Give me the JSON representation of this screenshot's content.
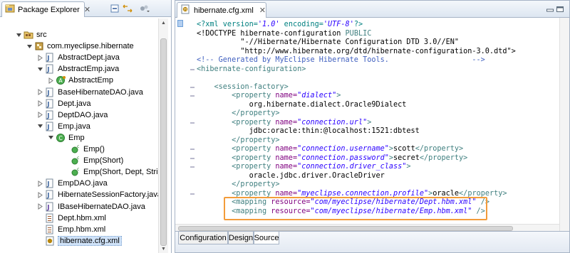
{
  "package_explorer": {
    "tab_label": "Package Explorer",
    "close_glyph": "✕",
    "toolbar_icons": [
      "collapse-all-icon",
      "link-with-editor-icon",
      "view-menu-icon"
    ],
    "tree": [
      {
        "label": "src",
        "icon": "source-folder-icon",
        "twisty": "expanded",
        "indent": 0
      },
      {
        "label": "com.myeclipse.hibernate",
        "icon": "package-icon",
        "twisty": "expanded",
        "indent": 1
      },
      {
        "label": "AbstractDept.java",
        "icon": "java-file-icon",
        "twisty": "collapsed",
        "indent": 2
      },
      {
        "label": "AbstractEmp.java",
        "icon": "java-file-icon",
        "twisty": "expanded",
        "indent": 2
      },
      {
        "label": "AbstractEmp",
        "icon": "abstract-class-icon",
        "twisty": "collapsed",
        "indent": 3
      },
      {
        "label": "BaseHibernateDAO.java",
        "icon": "java-file-icon",
        "twisty": "collapsed",
        "indent": 2
      },
      {
        "label": "Dept.java",
        "icon": "java-file-icon",
        "twisty": "collapsed",
        "indent": 2
      },
      {
        "label": "DeptDAO.java",
        "icon": "java-file-icon",
        "twisty": "collapsed",
        "indent": 2
      },
      {
        "label": "Emp.java",
        "icon": "java-file-icon",
        "twisty": "expanded",
        "indent": 2
      },
      {
        "label": "Emp",
        "icon": "class-icon",
        "twisty": "expanded",
        "indent": 3
      },
      {
        "label": "Emp()",
        "icon": "constructor-icon",
        "twisty": "none",
        "indent": 4
      },
      {
        "label": "Emp(Short)",
        "icon": "constructor-icon",
        "twisty": "none",
        "indent": 4
      },
      {
        "label": "Emp(Short, Dept, Strir",
        "icon": "constructor-icon",
        "twisty": "none",
        "indent": 4
      },
      {
        "label": "EmpDAO.java",
        "icon": "java-file-icon",
        "twisty": "collapsed",
        "indent": 2
      },
      {
        "label": "HibernateSessionFactory.java",
        "icon": "java-file-icon",
        "twisty": "collapsed",
        "indent": 2
      },
      {
        "label": "IBaseHibernateDAO.java",
        "icon": "interface-file-icon",
        "twisty": "collapsed",
        "indent": 2
      },
      {
        "label": "Dept.hbm.xml",
        "icon": "hbm-xml-icon",
        "twisty": "none",
        "indent": 2
      },
      {
        "label": "Emp.hbm.xml",
        "icon": "hbm-xml-icon",
        "twisty": "none",
        "indent": 2
      },
      {
        "label": "hibernate.cfg.xml",
        "icon": "hibernate-cfg-icon",
        "twisty": "none",
        "indent": 2,
        "selected": true
      }
    ]
  },
  "editor": {
    "tab_label": "hibernate.cfg.xml",
    "close_glyph": "✕",
    "lines": [
      [
        {
          "t": "<?xml version=",
          "c": "c-proc"
        },
        {
          "t": "'1.0'",
          "c": "c-val"
        },
        {
          "t": " encoding=",
          "c": "c-proc"
        },
        {
          "t": "'UTF-8'",
          "c": "c-val"
        },
        {
          "t": "?>",
          "c": "c-proc"
        }
      ],
      [
        {
          "t": "<!DOCTYPE hibernate-configuration ",
          "c": "c-dt"
        },
        {
          "t": "PUBLIC",
          "c": "c-tag"
        }
      ],
      [
        {
          "t": "          \"-//Hibernate/Hibernate Configuration DTD 3.0//EN\"",
          "c": "c-dt"
        }
      ],
      [
        {
          "t": "          \"http://www.hibernate.org/dtd/hibernate-configuration-3.0.dtd\">",
          "c": "c-dt"
        }
      ],
      [
        {
          "t": "<!-- Generated by MyEclipse Hibernate Tools.                   -->",
          "c": "c-cm"
        }
      ],
      [
        {
          "t": "<hibernate-configuration>",
          "c": "c-tag"
        }
      ],
      [],
      [
        {
          "t": "    <session-factory>",
          "c": "c-tag"
        }
      ],
      [
        {
          "t": "        <property ",
          "c": "c-tag"
        },
        {
          "t": "name=",
          "c": "c-attr"
        },
        {
          "t": "\"dialect\"",
          "c": "c-val"
        },
        {
          "t": ">",
          "c": "c-tag"
        }
      ],
      [
        {
          "t": "            org.hibernate.dialect.Oracle9Dialect",
          "c": "c-txt"
        }
      ],
      [
        {
          "t": "        </property>",
          "c": "c-tag"
        }
      ],
      [
        {
          "t": "        <property ",
          "c": "c-tag"
        },
        {
          "t": "name=",
          "c": "c-attr"
        },
        {
          "t": "\"connection.url\"",
          "c": "c-val"
        },
        {
          "t": ">",
          "c": "c-tag"
        }
      ],
      [
        {
          "t": "            jdbc:oracle:thin:@localhost:1521:dbtest",
          "c": "c-txt"
        }
      ],
      [
        {
          "t": "        </property>",
          "c": "c-tag"
        }
      ],
      [
        {
          "t": "        <property ",
          "c": "c-tag"
        },
        {
          "t": "name=",
          "c": "c-attr"
        },
        {
          "t": "\"connection.username\"",
          "c": "c-val"
        },
        {
          "t": ">",
          "c": "c-tag"
        },
        {
          "t": "scott",
          "c": "c-txt"
        },
        {
          "t": "</property>",
          "c": "c-tag"
        }
      ],
      [
        {
          "t": "        <property ",
          "c": "c-tag"
        },
        {
          "t": "name=",
          "c": "c-attr"
        },
        {
          "t": "\"connection.password\"",
          "c": "c-val"
        },
        {
          "t": ">",
          "c": "c-tag"
        },
        {
          "t": "secret",
          "c": "c-txt"
        },
        {
          "t": "</property>",
          "c": "c-tag"
        }
      ],
      [
        {
          "t": "        <property ",
          "c": "c-tag"
        },
        {
          "t": "name=",
          "c": "c-attr"
        },
        {
          "t": "\"connection.driver_class\"",
          "c": "c-val"
        },
        {
          "t": ">",
          "c": "c-tag"
        }
      ],
      [
        {
          "t": "            oracle.jdbc.driver.OracleDriver",
          "c": "c-txt"
        }
      ],
      [
        {
          "t": "        </property>",
          "c": "c-tag"
        }
      ],
      [
        {
          "t": "        <property ",
          "c": "c-tag"
        },
        {
          "t": "name=",
          "c": "c-attr"
        },
        {
          "t": "\"myeclipse.connection.profile\"",
          "c": "c-val"
        },
        {
          "t": ">",
          "c": "c-tag"
        },
        {
          "t": "oracle",
          "c": "c-txt"
        },
        {
          "t": "</property>",
          "c": "c-tag"
        }
      ],
      [
        {
          "t": "        <mapping ",
          "c": "c-tag"
        },
        {
          "t": "resource=",
          "c": "c-attr"
        },
        {
          "t": "\"com/myeclipse/hibernate/Dept.hbm.xml\"",
          "c": "c-val"
        },
        {
          "t": " />",
          "c": "c-tag"
        }
      ],
      [
        {
          "t": "        <mapping ",
          "c": "c-tag"
        },
        {
          "t": "resource=",
          "c": "c-attr"
        },
        {
          "t": "\"com/myeclipse/hibernate/Emp.hbm.xml\"",
          "c": "c-val"
        },
        {
          "t": " />",
          "c": "c-tag"
        }
      ]
    ],
    "fold_markers": [
      5,
      7,
      8,
      11,
      14,
      15,
      16,
      19
    ],
    "bottom_tabs": [
      {
        "label": "Configuration",
        "active": false
      },
      {
        "label": "Design",
        "active": false
      },
      {
        "label": "Source",
        "active": true
      }
    ],
    "colors": {
      "highlight_box": "#f39c3b",
      "tag": "#3f7f7f",
      "attr": "#7f007f",
      "value": "#2a00ff",
      "comment": "#3f5fbf"
    }
  }
}
